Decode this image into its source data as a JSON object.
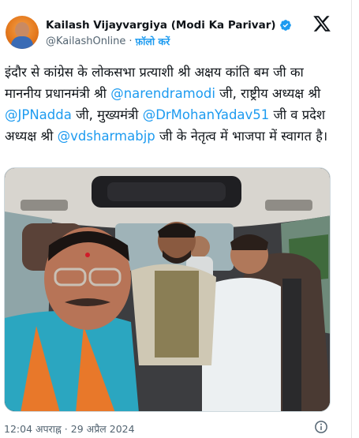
{
  "tweet": {
    "author": {
      "display_name": "Kailash Vijayvargiya (Modi Ka Parivar)",
      "handle": "@KailashOnline",
      "separator": "·",
      "follow_label": "फ़ॉलो करें",
      "verified_color": "#1d9bf0"
    },
    "text": {
      "part1": "इंदौर से कांग्रेस के लोकसभा प्रत्याशी श्री अक्षय कांति बम जी का माननीय प्रधानमंत्री श्री ",
      "mention1": "@narendramodi",
      "part2": " जी, राष्ट्रीय अध्यक्ष श्री ",
      "mention2": "@JPNadda",
      "part3": " जी, मुख्यमंत्री ",
      "mention3": "@DrMohanYadav51",
      "part4": " जी व प्रदेश अध्यक्ष श्री ",
      "mention4": "@vdsharmabjp",
      "part5": " जी के नेतृत्व में भाजपा में स्वागत है।"
    },
    "timestamp": {
      "time": "12:04 अपराह्न",
      "separator": "·",
      "date": "29 अप्रैल 2024"
    },
    "icons": {
      "platform": "x-logo-icon",
      "verified": "verified-badge-icon",
      "info": "info-icon"
    },
    "colors": {
      "link": "#1d9bf0",
      "text": "#0f1419",
      "secondary": "#536471"
    }
  }
}
